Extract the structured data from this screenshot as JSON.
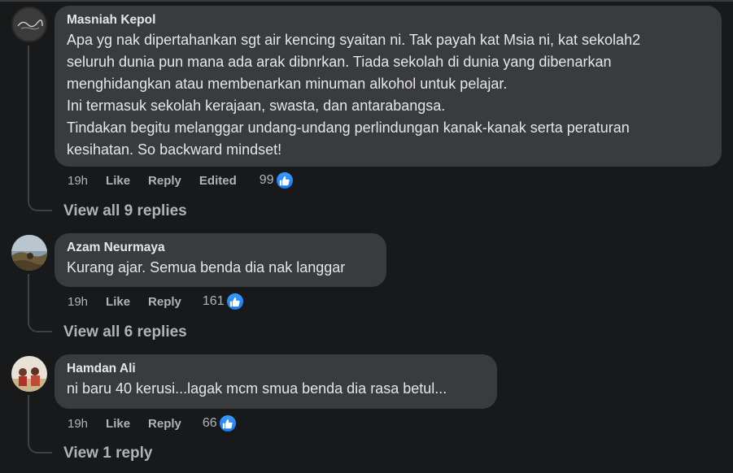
{
  "comments": [
    {
      "author": "Masniah Kepol",
      "text": "Apa yg nak dipertahankan sgt air kencing syaitan ni. Tak payah kat Msia ni, kat sekolah2\nseluruh dunia pun mana ada arak dibnrkan. Tiada sekolah di dunia yang dibenarkan\nmenghidangkan atau membenarkan minuman alkohol untuk pelajar.\nIni termasuk sekolah kerajaan, swasta, dan antarabangsa.\nTindakan begitu melanggar undang-undang perlindungan kanak-kanak serta peraturan\nkesihatan. So backward mindset!",
      "time": "19h",
      "like_label": "Like",
      "reply_label": "Reply",
      "edited_label": "Edited",
      "reaction_count": "99",
      "view_replies": "View all 9 replies"
    },
    {
      "author": "Azam Neurmaya",
      "text": "Kurang ajar. Semua benda dia nak langgar",
      "time": "19h",
      "like_label": "Like",
      "reply_label": "Reply",
      "reaction_count": "161",
      "view_replies": "View all 6 replies"
    },
    {
      "author": "Hamdan Ali",
      "text": "ni baru 40 kerusi...lagak mcm smua benda dia rasa betul...",
      "time": "19h",
      "like_label": "Like",
      "reply_label": "Reply",
      "reaction_count": "66",
      "view_replies": "View 1 reply"
    }
  ],
  "colors": {
    "background": "#18191a",
    "bubble": "#3a3b3c",
    "text": "#e4e6eb",
    "secondary_text": "#b0b3b8",
    "like_blue": "#1877f2"
  }
}
